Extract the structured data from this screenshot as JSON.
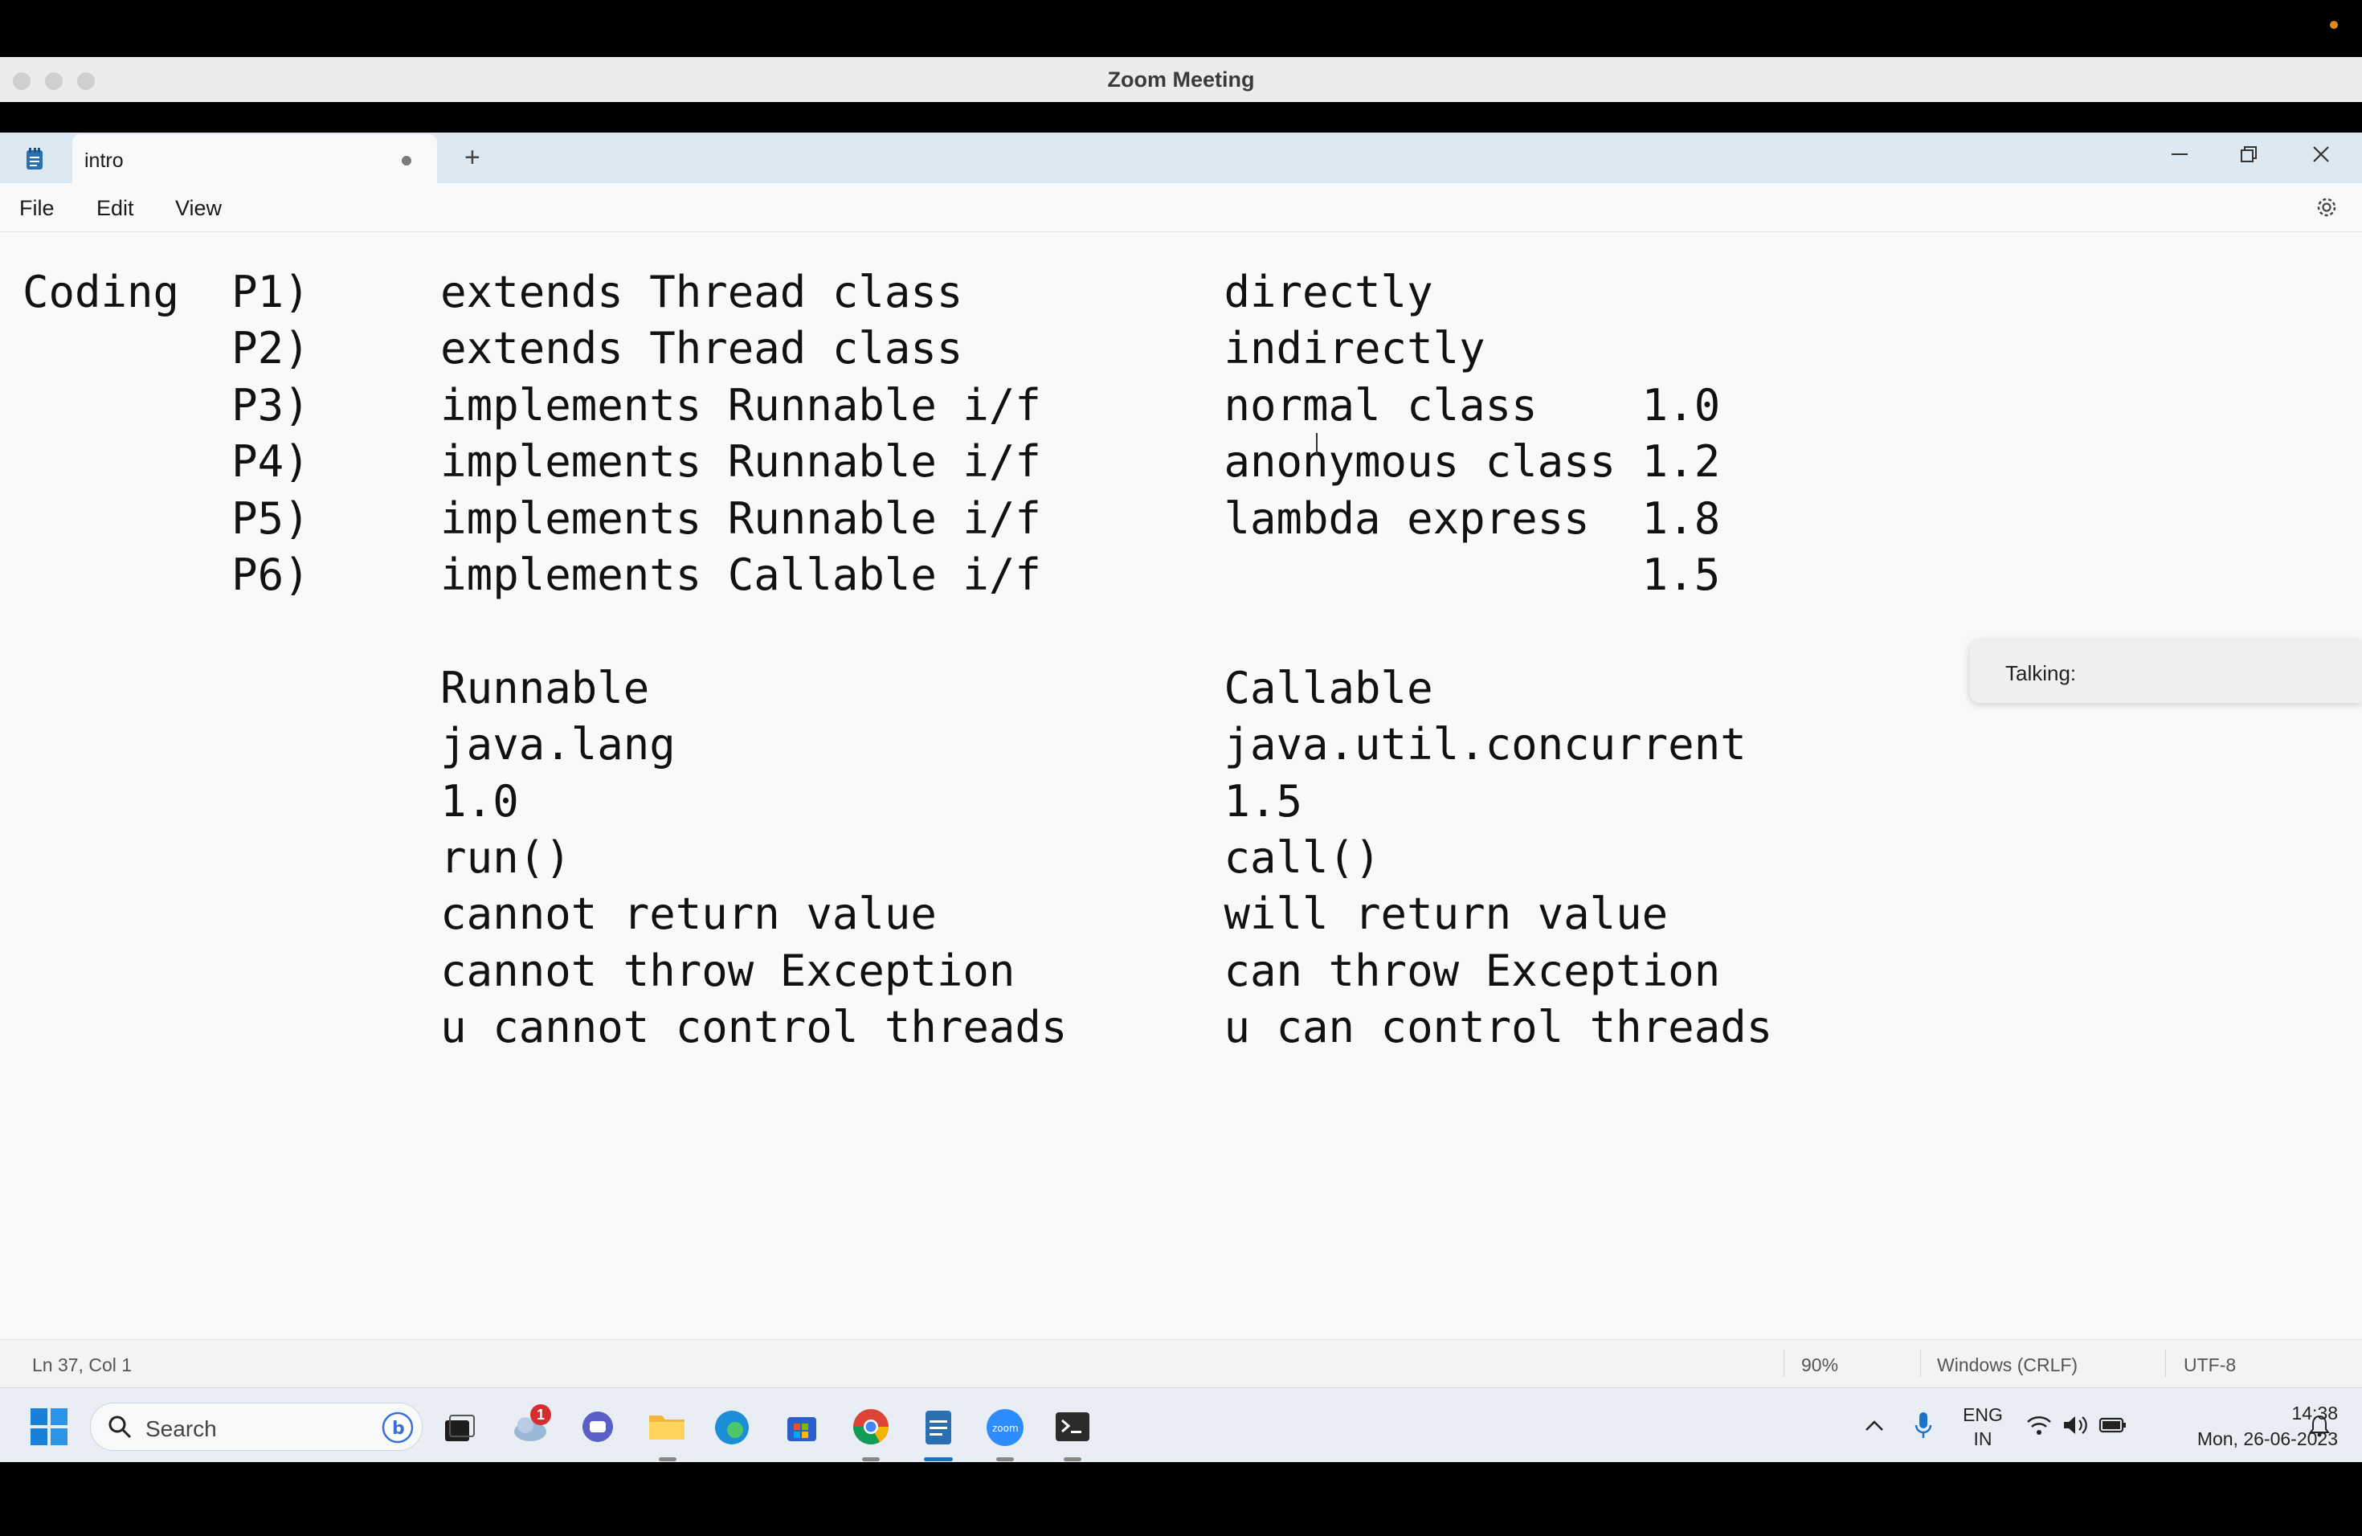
{
  "zoom_window": {
    "title": "Zoom Meeting"
  },
  "notepad": {
    "tab_title": "intro",
    "menu": [
      "File",
      "Edit",
      "View"
    ],
    "content_lines": [
      "Coding  P1)     extends Thread class          directly",
      "        P2)     extends Thread class          indirectly",
      "        P3)     implements Runnable i/f       normal class    1.0",
      "        P4)     implements Runnable i/f       anonymous class 1.2",
      "        P5)     implements Runnable i/f       lambda express  1.8",
      "        P6)     implements Callable i/f                       1.5",
      "",
      "                Runnable                      Callable",
      "                java.lang                     java.util.concurrent",
      "                1.0                           1.5",
      "                run()                         call()",
      "                cannot return value           will return value",
      "                cannot throw Exception        can throw Exception",
      "                u cannot control threads      u can control threads"
    ],
    "status": {
      "position": "Ln 37, Col 1",
      "zoom": "90%",
      "line_ending": "Windows (CRLF)",
      "encoding": "UTF-8"
    }
  },
  "talking_popup": {
    "label": "Talking:"
  },
  "taskbar": {
    "search_placeholder": "Search",
    "notification_badge": "1",
    "language_primary": "ENG",
    "language_secondary": "IN",
    "time": "14:38",
    "date": "Mon, 26-06-2023"
  }
}
